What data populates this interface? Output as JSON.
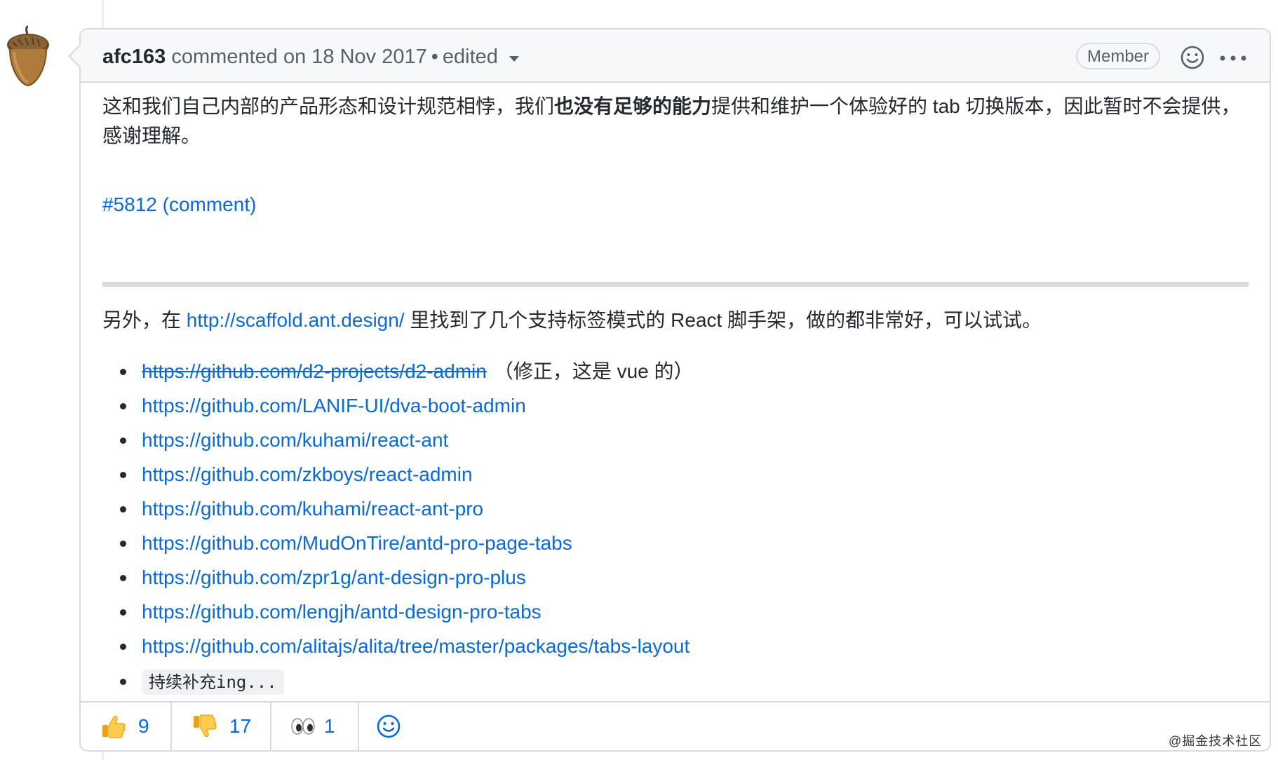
{
  "comment": {
    "author": "afc163",
    "meta": "commented on 18 Nov 2017",
    "separator": "•",
    "edited": "edited",
    "badge": "Member",
    "paragraph1": {
      "pre": "这和我们自己内部的产品形态和设计规范相悖，我们",
      "bold": "也没有足够的能力",
      "post": "提供和维护一个体验好的 tab 切换版本，因此暂时不会提供，",
      "line2": "感谢理解。"
    },
    "issue_link": "#5812 (comment)",
    "paragraph2": {
      "pre": "另外，在 ",
      "link": "http://scaffold.ant.design/",
      "post": " 里找到了几个支持标签模式的 React 脚手架，做的都非常好，可以试试。"
    },
    "links": [
      {
        "url": "https://github.com/d2-projects/d2-admin",
        "note": "（修正，这是 vue 的）"
      },
      {
        "url": "https://github.com/LANIF-UI/dva-boot-admin"
      },
      {
        "url": "https://github.com/kuhami/react-ant"
      },
      {
        "url": "https://github.com/zkboys/react-admin"
      },
      {
        "url": "https://github.com/kuhami/react-ant-pro"
      },
      {
        "url": "https://github.com/MudOnTire/antd-pro-page-tabs"
      },
      {
        "url": "https://github.com/zpr1g/ant-design-pro-plus"
      },
      {
        "url": "https://github.com/lengjh/antd-design-pro-tabs"
      },
      {
        "url": "https://github.com/alitajs/alita/tree/master/packages/tabs-layout"
      }
    ],
    "last_item_code": "持续补充ing..."
  },
  "reactions": [
    {
      "icon": "thumbs-up-icon",
      "count": "9"
    },
    {
      "icon": "thumbs-down-icon",
      "count": "17"
    },
    {
      "icon": "eyes-icon",
      "count": "1"
    }
  ],
  "watermark": "@掘金技术社区",
  "colors": {
    "link": "#0969da",
    "border": "#d7dce1",
    "header_bg": "#f6f8fa",
    "text": "#24292f",
    "muted": "#57606a"
  }
}
